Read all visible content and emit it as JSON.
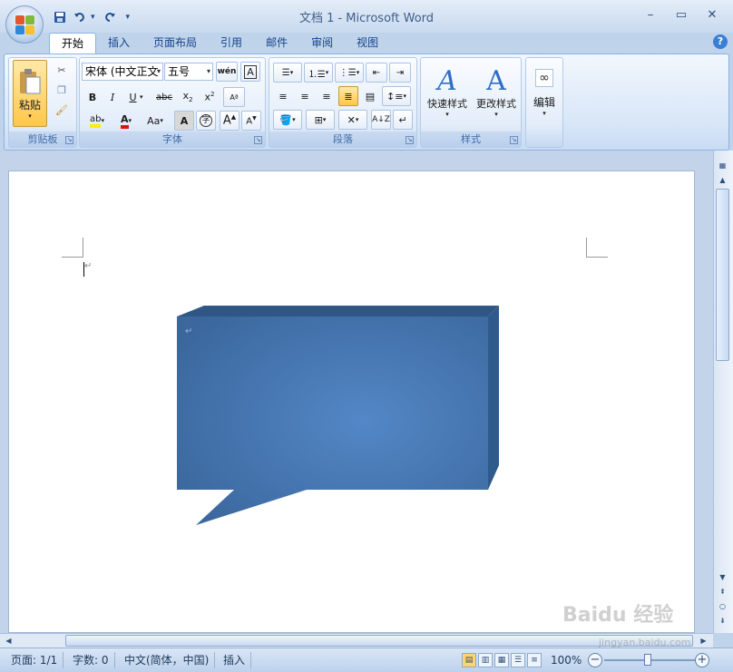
{
  "window": {
    "title": "文档 1 - Microsoft Word"
  },
  "qat": {
    "save_icon": "save-icon",
    "undo_icon": "undo-icon",
    "redo_icon": "redo-icon",
    "customize_icon": "customize-qat-icon"
  },
  "tabs": [
    {
      "label": "开始"
    },
    {
      "label": "插入"
    },
    {
      "label": "页面布局"
    },
    {
      "label": "引用"
    },
    {
      "label": "邮件"
    },
    {
      "label": "审阅"
    },
    {
      "label": "视图"
    }
  ],
  "ribbon": {
    "clipboard": {
      "label": "剪贴板",
      "paste_label": "粘贴"
    },
    "font": {
      "label": "字体",
      "font_name": "宋体 (中文正文",
      "font_size": "五号"
    },
    "paragraph": {
      "label": "段落"
    },
    "styles": {
      "label": "样式",
      "quick_styles": "快速样式",
      "change_styles": "更改样式"
    },
    "editing": {
      "label": "编辑"
    }
  },
  "statusbar": {
    "page": "页面: 1/1",
    "words": "字数: 0",
    "language": "中文(简体，中国)",
    "mode": "插入",
    "zoom": "100%"
  },
  "watermark": {
    "text": "Baidu 经验",
    "url_text": "jingyan.baidu.com"
  },
  "colors": {
    "shape_fill": "#3d6aa0",
    "shape_highlight": "#4f80bf",
    "ribbon_border": "#8db2e3"
  }
}
